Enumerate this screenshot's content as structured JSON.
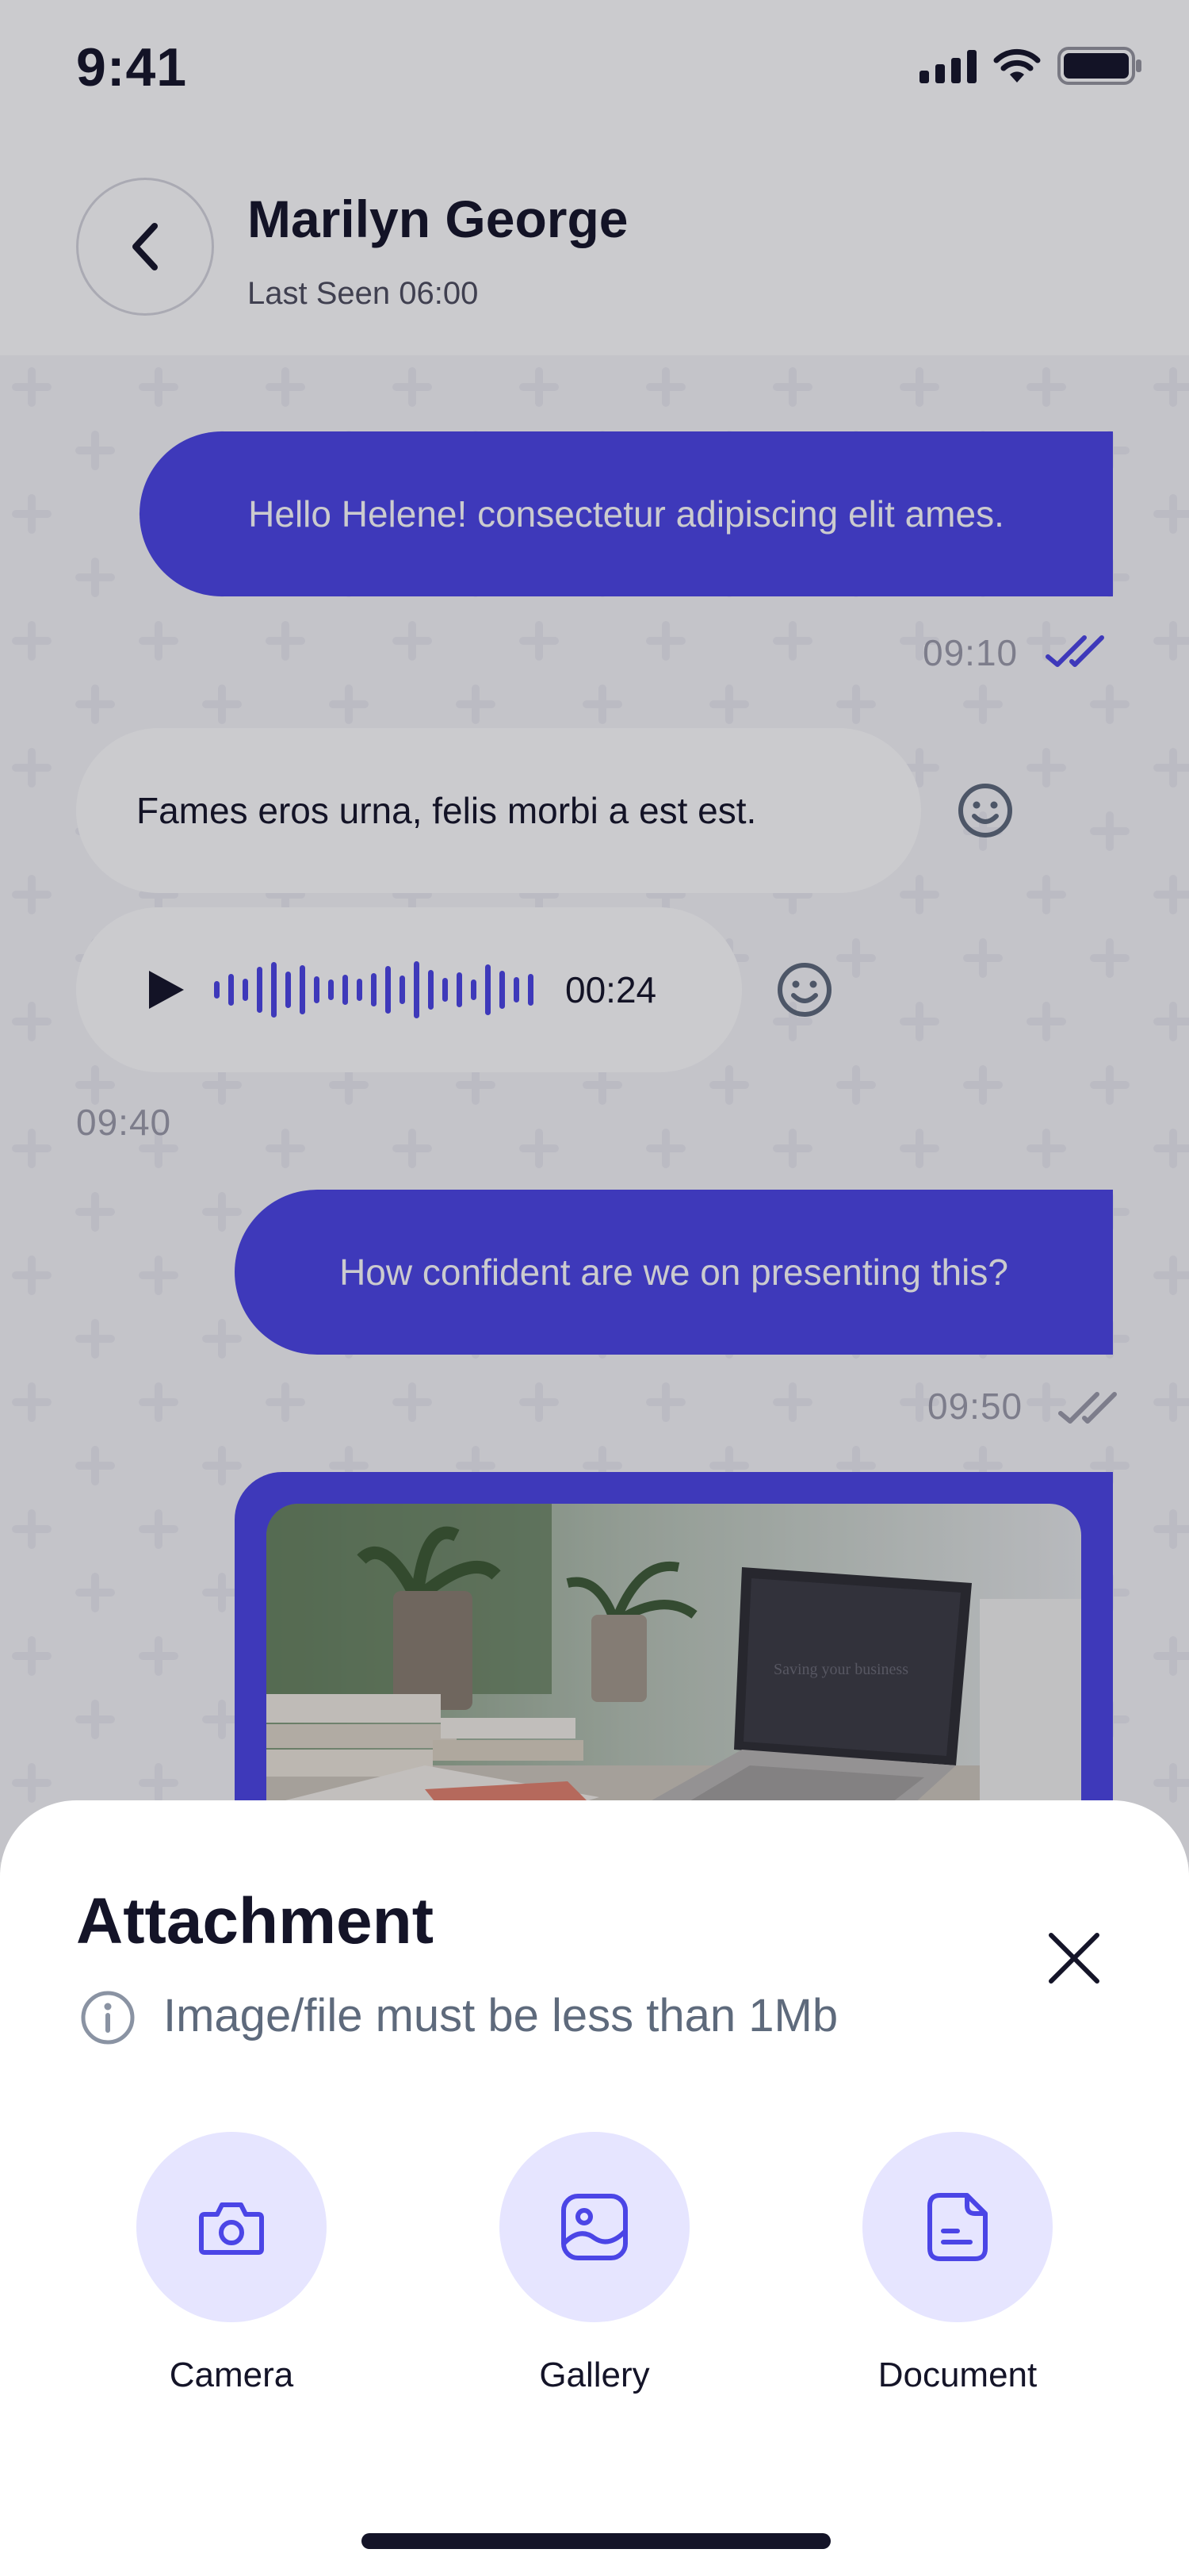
{
  "status_bar": {
    "time": "9:41"
  },
  "header": {
    "contact_name": "Marilyn George",
    "last_seen": "Last Seen 06:00"
  },
  "messages": [
    {
      "direction": "outgoing",
      "type": "text",
      "text": "Hello Helene! consectetur adipiscing elit ames.",
      "time": "09:10",
      "read": true
    },
    {
      "direction": "incoming",
      "type": "text",
      "text": "Fames eros urna, felis morbi a est est."
    },
    {
      "direction": "incoming",
      "type": "voice",
      "duration": "00:24",
      "time": "09:40"
    },
    {
      "direction": "outgoing",
      "type": "text",
      "text": "How confident are we on presenting this?",
      "time": "09:50",
      "read": false
    },
    {
      "direction": "outgoing",
      "type": "image",
      "image": "photo of laptop and books on a desk",
      "screen_text": "Saving your business"
    }
  ],
  "sheet": {
    "title": "Attachment",
    "hint": "Image/file must be less than 1Mb",
    "options": [
      {
        "label": "Camera",
        "icon": "camera-icon"
      },
      {
        "label": "Gallery",
        "icon": "image-icon"
      },
      {
        "label": "Document",
        "icon": "document-icon"
      }
    ]
  },
  "colors": {
    "accent": "#4b45e6",
    "accent_light": "#e6e5ff",
    "text": "#141428",
    "muted": "#9b9baa",
    "read_ticks": "#4b45e6",
    "unread_ticks": "#9b9baa"
  }
}
